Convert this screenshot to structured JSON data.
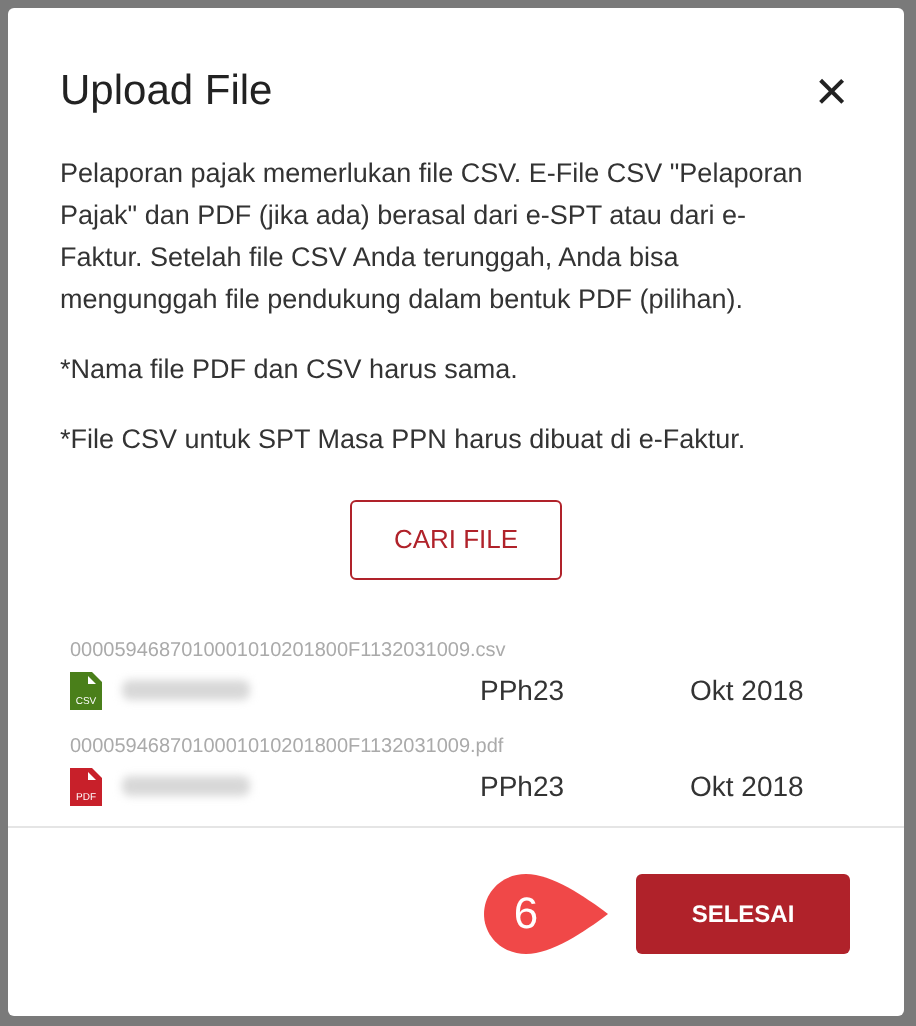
{
  "dialog": {
    "title": "Upload File",
    "close": "×",
    "paragraphs": [
      "Pelaporan pajak memerlukan file CSV. E-File CSV \"Pelaporan Pajak\" dan PDF (jika ada) berasal dari e-SPT atau dari e-Faktur. Setelah file CSV Anda terunggah, Anda bisa mengunggah file pendukung dalam bentuk PDF (pilihan).",
      "*Nama file PDF dan CSV harus sama.",
      "*File CSV untuk SPT Masa PPN harus dibuat di e-Faktur."
    ],
    "browse_button": "CARI FILE",
    "files": [
      {
        "filename": "0000594687010001010201800F1132031009.csv",
        "kind": "csv",
        "type_label": "CSV",
        "tax": "PPh23",
        "period": "Okt 2018"
      },
      {
        "filename": "0000594687010001010201800F1132031009.pdf",
        "kind": "pdf",
        "type_label": "PDF",
        "tax": "PPh23",
        "period": "Okt 2018"
      }
    ],
    "callout": "6",
    "done_button": "SELESAI"
  }
}
